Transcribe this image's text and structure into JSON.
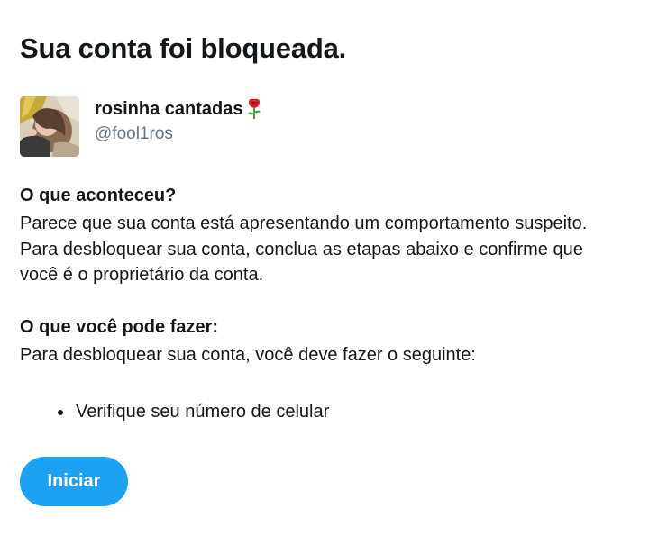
{
  "page": {
    "title": "Sua conta foi bloqueada."
  },
  "account": {
    "display_name": "rosinha cantadas",
    "handle": "@fool1ros",
    "name_icon": "rose-icon"
  },
  "what_happened": {
    "heading": "O que aconteceu?",
    "body": "Parece que sua conta está apresentando um comportamento suspeito. Para desbloquear sua conta, conclua as etapas abaixo e confirme que você é o proprietário da conta."
  },
  "what_to_do": {
    "heading": "O que você pode fazer:",
    "body": "Para desbloquear sua conta, você deve fazer o seguinte:",
    "steps": [
      "Verifique seu número de celular"
    ]
  },
  "actions": {
    "start_label": "Iniciar"
  },
  "colors": {
    "primary": "#1da1f2",
    "text": "#14171a",
    "secondary_text": "#657786"
  }
}
